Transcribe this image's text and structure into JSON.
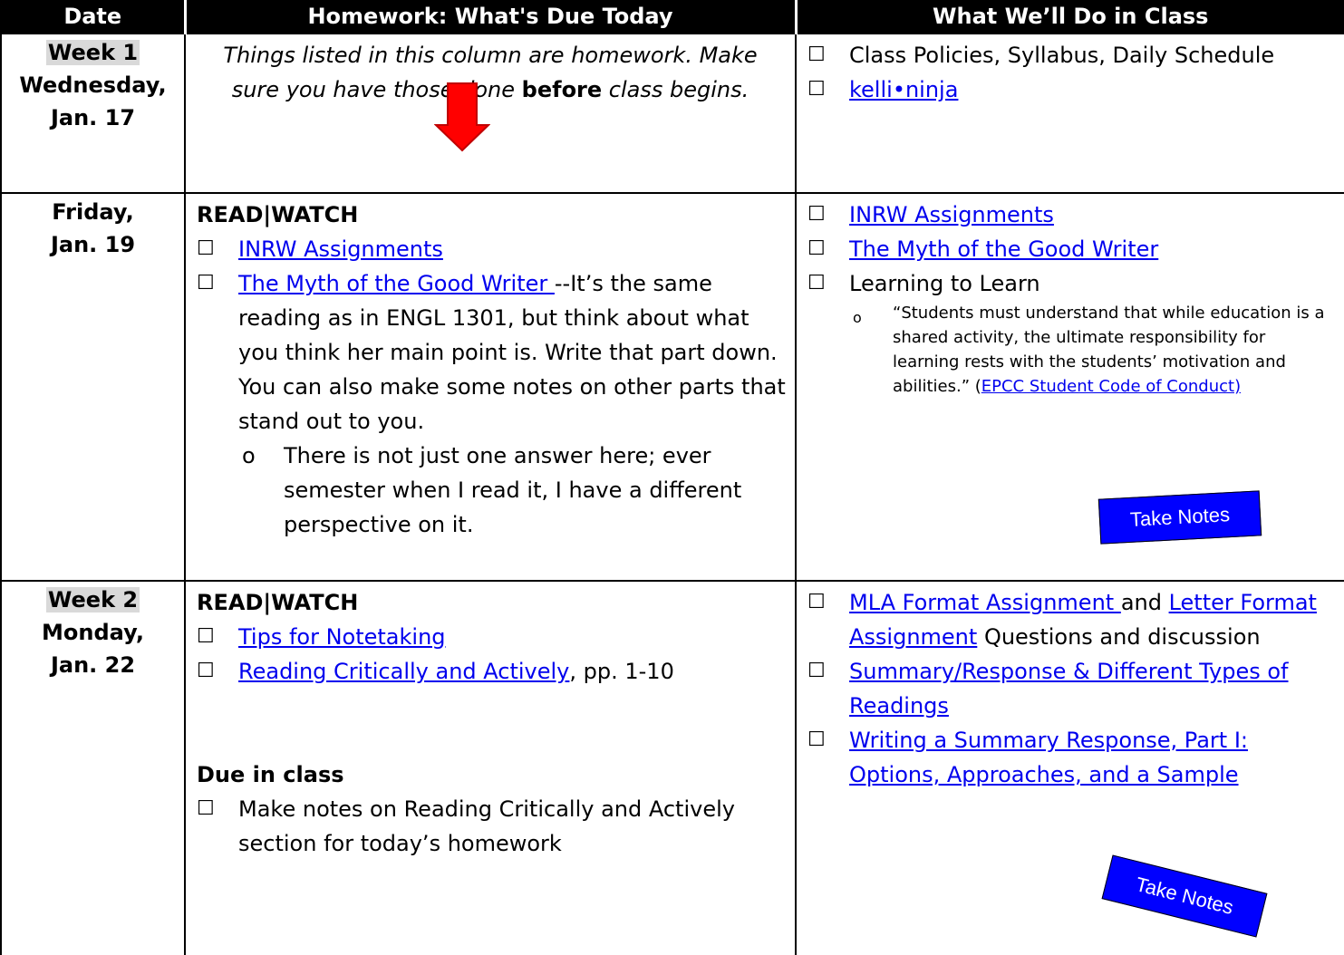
{
  "header": {
    "date": "Date",
    "homework": "Homework: What's Due Today",
    "class": "What We’ll Do in Class"
  },
  "row1": {
    "week": "Week 1",
    "day": "Wednesday,",
    "date": "Jan. 17",
    "note_a": "Things listed in this column are homework.  Make sure you have those done ",
    "note_b": "before",
    "note_c": " class begins.",
    "class_items": [
      "Class Policies, Syllabus, Daily Schedule",
      "kelli•ninja"
    ]
  },
  "row2": {
    "day": "Friday,",
    "date": "Jan. 19",
    "hw_heading": "READ|WATCH",
    "hw_item1": "INRW Assignments",
    "hw_item2_link": "The Myth of the Good Writer ",
    "hw_item2_text": " --It’s the same reading as in ENGL 1301, but think about what you think her main point is.  Write that part down.  You can also make some notes on other parts that stand out to you.",
    "hw_sub": "There is not just one answer here; ever semester when I read it, I have a different perspective on it.",
    "class_item1": "INRW Assignments",
    "class_item2": "The Myth of the Good Writer",
    "class_item3": "Learning to Learn",
    "quote": "“Students must understand that while education is a shared activity, the ultimate responsibility for learning rests with the students’ motivation and abilities.” (",
    "quote_link": "EPCC Student Code of Conduct)",
    "notes_label": "Take Notes"
  },
  "row3": {
    "week": "Week 2",
    "day": "Monday,",
    "date": "Jan. 22",
    "hw_heading": "READ|WATCH",
    "hw_item1": "Tips for Notetaking",
    "hw_item2_link": "Reading Critically and Actively",
    "hw_item2_text": ", pp. 1-10",
    "due_heading": "Due in class",
    "due_item": "Make notes on Reading Critically and Actively section for today’s homework",
    "class_item1_link_a": "MLA Format Assignment ",
    "class_item1_and": "and ",
    "class_item1_link_b": "Letter Format Assignment",
    "class_item1_text": " Questions and discussion",
    "class_item2": "Summary/Response & Different Types of Readings",
    "class_item3": "Writing a Summary Response, Part I: Options, Approaches, and a Sample",
    "notes_label": "Take Notes"
  },
  "checkbox": "☐",
  "bullet": "o",
  "colors": {
    "header_bg": "#000000",
    "link": "#0000ee",
    "notes_bg": "#0000ff",
    "arrow": "#ff0000",
    "week_bg": "#d9d9d9"
  }
}
